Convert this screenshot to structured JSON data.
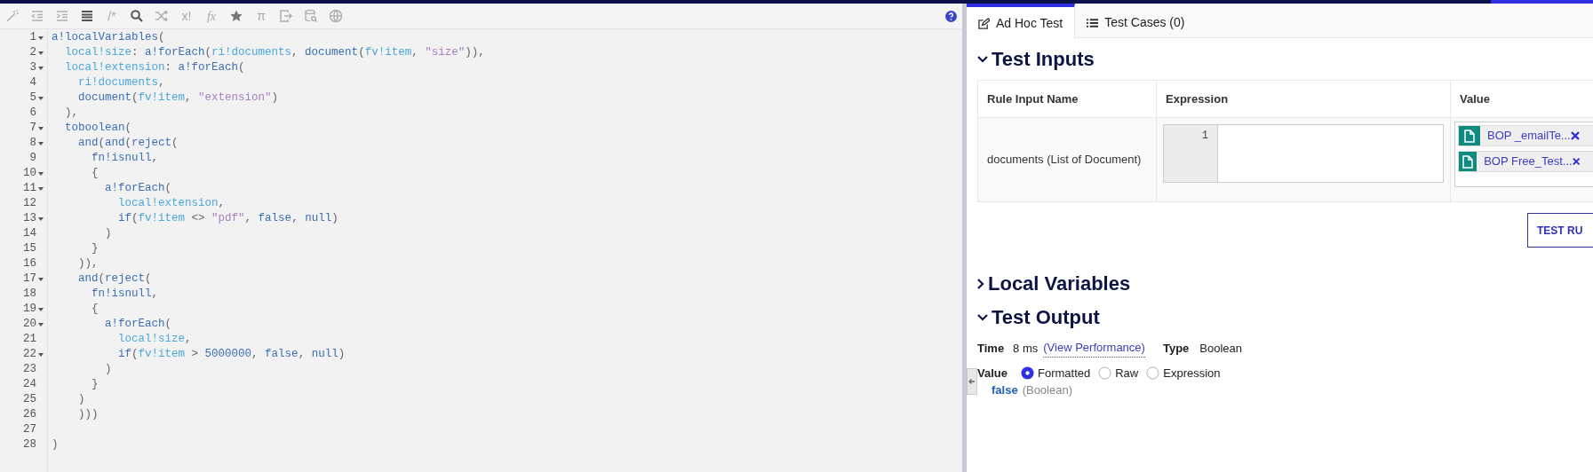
{
  "toolbar_glyphs": [
    "/*",
    "x!",
    "fx",
    "π"
  ],
  "code_lines": [
    {
      "number": "1",
      "foldable": true,
      "text": "a!localVariables("
    },
    {
      "number": "2",
      "foldable": true,
      "text": "  local!size: a!forEach(ri!documents, document(fv!item, \"size\")),"
    },
    {
      "number": "3",
      "foldable": true,
      "text": "  local!extension: a!forEach("
    },
    {
      "number": "4",
      "foldable": false,
      "text": "    ri!documents,"
    },
    {
      "number": "5",
      "foldable": true,
      "text": "    document(fv!item, \"extension\")"
    },
    {
      "number": "6",
      "foldable": false,
      "text": "  ),"
    },
    {
      "number": "7",
      "foldable": true,
      "text": "  toboolean("
    },
    {
      "number": "8",
      "foldable": true,
      "text": "    and(and(reject("
    },
    {
      "number": "9",
      "foldable": false,
      "text": "      fn!isnull,"
    },
    {
      "number": "10",
      "foldable": true,
      "text": "      {"
    },
    {
      "number": "11",
      "foldable": true,
      "text": "        a!forEach("
    },
    {
      "number": "12",
      "foldable": false,
      "text": "          local!extension,"
    },
    {
      "number": "13",
      "foldable": true,
      "text": "          if(fv!item <> \"pdf\", false, null)"
    },
    {
      "number": "14",
      "foldable": false,
      "text": "        )"
    },
    {
      "number": "15",
      "foldable": false,
      "text": "      }"
    },
    {
      "number": "16",
      "foldable": false,
      "text": "    )),"
    },
    {
      "number": "17",
      "foldable": true,
      "text": "    and(reject("
    },
    {
      "number": "18",
      "foldable": false,
      "text": "      fn!isnull,"
    },
    {
      "number": "19",
      "foldable": true,
      "text": "      {"
    },
    {
      "number": "20",
      "foldable": true,
      "text": "        a!forEach("
    },
    {
      "number": "21",
      "foldable": false,
      "text": "          local!size,"
    },
    {
      "number": "22",
      "foldable": true,
      "text": "          if(fv!item > 5000000, false, null)"
    },
    {
      "number": "23",
      "foldable": false,
      "text": "        )"
    },
    {
      "number": "24",
      "foldable": false,
      "text": "      }"
    },
    {
      "number": "25",
      "foldable": false,
      "text": "    )"
    },
    {
      "number": "26",
      "foldable": false,
      "text": "    )))"
    },
    {
      "number": "27",
      "foldable": false
    },
    {
      "number": "28",
      "foldable": false,
      "text": ")"
    }
  ],
  "tabs": [
    {
      "label": "Ad Hoc Test",
      "selected": true
    },
    {
      "label": "Test Cases (0)",
      "selected": false
    }
  ],
  "test_inputs": {
    "title": "Test Inputs",
    "expanded": true,
    "columns": [
      "Rule Input Name",
      "Expression",
      "Value"
    ],
    "rows": [
      {
        "name": "documents (List of Document)",
        "line_number": "1",
        "values": [
          "BOP _emailTe...",
          "BOP Free_Test..."
        ]
      }
    ],
    "button": "TEST RU"
  },
  "local_variables": {
    "title": "Local Variables",
    "expanded": false
  },
  "test_output": {
    "title": "Test Output",
    "expanded": true,
    "time_label": "Time",
    "time": "8 ms",
    "performance_link": "(View Performance)",
    "type_label": "Type",
    "type": "Boolean",
    "value_label": "Value",
    "formats": [
      {
        "label": "Formatted",
        "selected": true
      },
      {
        "label": "Raw",
        "selected": false
      },
      {
        "label": "Expression",
        "selected": false
      }
    ],
    "result": "false",
    "result_type": "(Boolean)"
  }
}
